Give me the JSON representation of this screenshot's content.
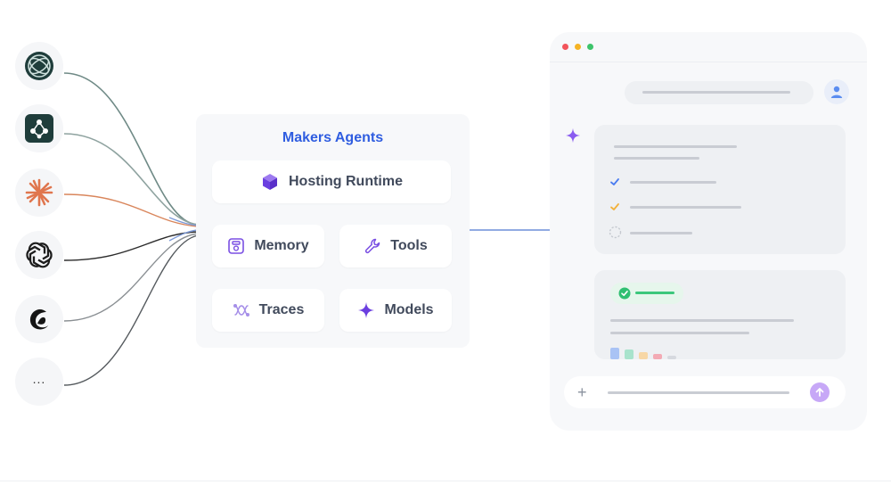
{
  "providers": [
    {
      "name": "globe-logo-icon"
    },
    {
      "name": "hub-logo-icon"
    },
    {
      "name": "sunburst-logo-icon"
    },
    {
      "name": "knot-logo-icon"
    },
    {
      "name": "swirl-logo-icon"
    },
    {
      "name": "more-icon",
      "label": "..."
    }
  ],
  "hub": {
    "title": "Makers Agents",
    "hosting_label": "Hosting Runtime",
    "memory_label": "Memory",
    "tools_label": "Tools",
    "traces_label": "Traces",
    "models_label": "Models"
  },
  "colors": {
    "accent": "#2f5de0",
    "line_teal": "#5d7d7a",
    "line_orange": "#d9865c",
    "line_dark": "#2b2b2b",
    "line_blue": "#6d8fd8",
    "chip_icon_purple": "#7a4fe3",
    "check_blue": "#4a7cf0",
    "check_orange": "#f2b13a",
    "success_green": "#2fbf71"
  },
  "chat_window": {
    "traffic_lights": [
      "#f2545b",
      "#f5b324",
      "#3dc46b"
    ]
  }
}
